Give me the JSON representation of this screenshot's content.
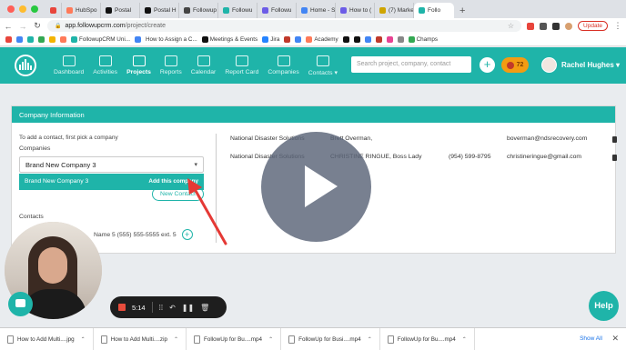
{
  "browser": {
    "tabs": [
      {
        "label": "",
        "color": "#e8453c"
      },
      {
        "label": "HubSpo",
        "color": "#ff7a59"
      },
      {
        "label": "Postal",
        "color": "#111111"
      },
      {
        "label": "Postal H",
        "color": "#111111"
      },
      {
        "label": "Followup",
        "color": "#444444"
      },
      {
        "label": "Followu",
        "color": "#1fb4a9"
      },
      {
        "label": "Followu",
        "color": "#6c5ce7"
      },
      {
        "label": "Home - S",
        "color": "#4285f4"
      },
      {
        "label": "How to (",
        "color": "#6c5ce7"
      },
      {
        "label": "(7) Marke",
        "color": "#cfa500"
      },
      {
        "label": "Follo",
        "color": "#1fb4a9",
        "active": true
      }
    ],
    "url_host": "app.followupcrm.com",
    "url_path": "/project/create",
    "update_label": "Update",
    "bookmarks": [
      "FollowupCRM Uni...",
      "How to Assign a C...",
      "Meetings & Events",
      "Jira",
      "Academy",
      "Champs"
    ]
  },
  "app": {
    "nav": [
      {
        "label": "Dashboard"
      },
      {
        "label": "Activities"
      },
      {
        "label": "Projects",
        "active": true
      },
      {
        "label": "Reports"
      },
      {
        "label": "Calendar"
      },
      {
        "label": "Report Card"
      },
      {
        "label": "Companies"
      },
      {
        "label": "Contacts ▾"
      }
    ],
    "search_placeholder": "Search project, company, contact",
    "notif_count": "72",
    "user_name": "Rachel Hughes ▾"
  },
  "card": {
    "title": "Company Information",
    "hint": "To add a contact, first pick a company",
    "companies_label": "Companies",
    "selected_company": "Brand New Company 3",
    "dropdown_option": "Brand New Company 3",
    "dropdown_action": "Add this company",
    "new_contact_label": "New Contact",
    "contacts_label": "Contacts",
    "contact_entry": "Name 5   (555) 555-5555 ext. 5",
    "results": [
      {
        "company": "National Disaster Solutions",
        "contact": "Brett Overman,",
        "phone": "",
        "email": "boverman@ndsrecovery.com"
      },
      {
        "company": "National Disaster Solutions",
        "contact": "CHRISTINE RINGUE, Boss Lady",
        "phone": "(954) 599-8795",
        "email": "christineringue@gmail.com"
      }
    ]
  },
  "recorder": {
    "time": "5:14"
  },
  "help_label": "Help",
  "downloads": {
    "items": [
      "How to Add Multi....jpg",
      "How to Add Multi....zip",
      "FollowUp for Bu....mp4",
      "FollowUp for Busi....mp4",
      "FollowUp for Bu....mp4"
    ],
    "show_all": "Show All"
  }
}
